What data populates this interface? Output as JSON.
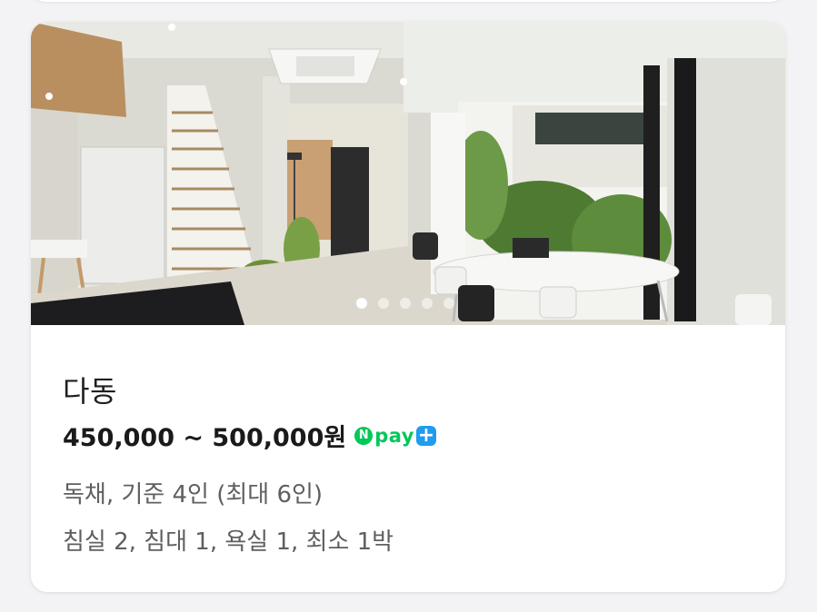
{
  "listing": {
    "name": "다동",
    "price_range": "450,000 ~ 500,000원",
    "badge": {
      "n_letter": "N",
      "text": "pay",
      "plus": "+",
      "color_green": "#03c75a",
      "color_blue": "#1f9cf0"
    },
    "details": [
      "독채, 기준 4인 (최대 6인)",
      "침실 2, 침대 1, 욕실 1, 최소 1박"
    ],
    "carousel": {
      "total": 5,
      "active_index": 0
    }
  }
}
